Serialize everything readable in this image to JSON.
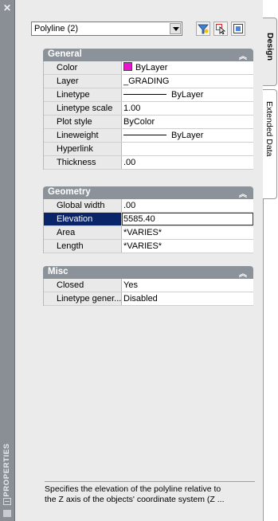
{
  "palette": {
    "title": "PROPERTIES",
    "colors": {
      "titlebar": "#8a8f96",
      "section_header": "#8c9299",
      "selected_row": "#0a246a",
      "layer_color_swatch": "#e815cf"
    }
  },
  "selector": {
    "value": "Polyline (2)"
  },
  "toolbar": {
    "toggle_pickadd_icon": "quick-select-filter-icon",
    "select_objects_icon": "select-objects-icon",
    "quick_select_icon": "quick-select-icon"
  },
  "sections": {
    "general": {
      "title": "General",
      "rows": [
        {
          "name": "Color",
          "value": "ByLayer"
        },
        {
          "name": "Layer",
          "value": "_GRADING"
        },
        {
          "name": "Linetype",
          "value": "ByLayer"
        },
        {
          "name": "Linetype scale",
          "value": "1.00"
        },
        {
          "name": "Plot style",
          "value": "ByColor"
        },
        {
          "name": "Lineweight",
          "value": "ByLayer"
        },
        {
          "name": "Hyperlink",
          "value": ""
        },
        {
          "name": "Thickness",
          "value": ".00"
        }
      ]
    },
    "geometry": {
      "title": "Geometry",
      "rows": [
        {
          "name": "Global width",
          "value": ".00"
        },
        {
          "name": "Elevation",
          "value": "5585.40"
        },
        {
          "name": "Area",
          "value": "*VARIES*"
        },
        {
          "name": "Length",
          "value": "*VARIES*"
        }
      ]
    },
    "misc": {
      "title": "Misc",
      "rows": [
        {
          "name": "Closed",
          "value": "Yes"
        },
        {
          "name": "Linetype gener...",
          "value": "Disabled"
        }
      ]
    }
  },
  "description": {
    "line1": "Specifies the elevation of the polyline relative to",
    "line2": "the Z axis of the objects' coordinate system (Z ..."
  },
  "tabs": {
    "design": "Design",
    "extended": "Extended Data"
  }
}
